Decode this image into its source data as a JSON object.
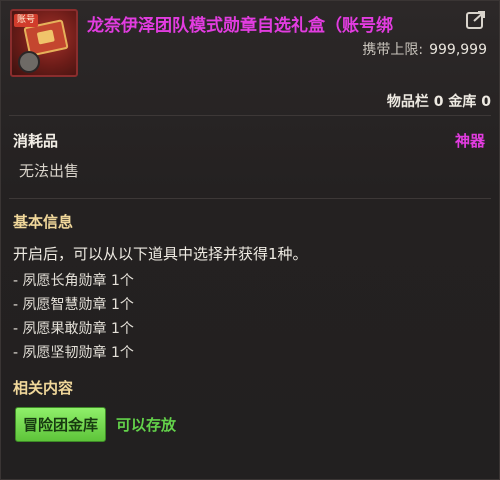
{
  "item": {
    "title": "龙奈伊泽团队模式勋章自选礼盒（账号绑",
    "icon_tag": "账号",
    "carry_limit_label": "携带上限:",
    "carry_limit_value": "999,999",
    "counts": "物品栏 0 金库 0"
  },
  "details": {
    "type_label": "消耗品",
    "rarity_label": "神器",
    "trade_status": "无法出售"
  },
  "basic_info": {
    "title": "基本信息",
    "description": "开启后，可以从以下道具中选择并获得1种。",
    "rewards": [
      "- 夙愿长角勋章 1个",
      "- 夙愿智慧勋章 1个",
      "- 夙愿果敢勋章 1个",
      "- 夙愿坚韧勋章 1个"
    ]
  },
  "related": {
    "title": "相关内容",
    "storage_button": "冒险团金库",
    "storage_status": "可以存放"
  },
  "colors": {
    "title_magenta": "#e23ce0",
    "section_gold": "#f0d79a",
    "button_green": "#5ec43a",
    "status_green": "#63d24a"
  },
  "icons": {
    "item": "gift-box-icon",
    "share": "share-icon"
  }
}
